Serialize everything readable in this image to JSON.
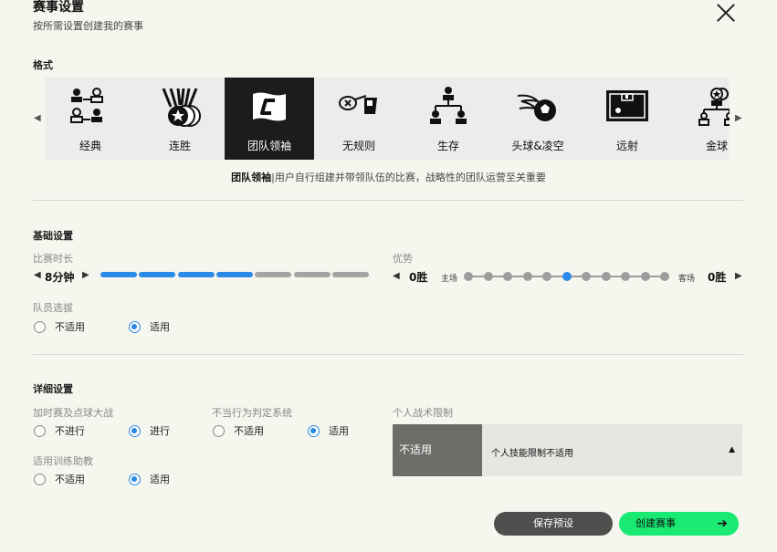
{
  "header": {
    "title": "赛事设置",
    "subtitle": "按所需设置创建我的赛事"
  },
  "format": {
    "section_label": "格式",
    "items": [
      {
        "label": "经典",
        "icon": "bracket-players-icon"
      },
      {
        "label": "连胜",
        "icon": "medals-icon"
      },
      {
        "label": "团队领袖",
        "icon": "captain-flag-icon",
        "selected": true
      },
      {
        "label": "无规则",
        "icon": "whistle-card-icon"
      },
      {
        "label": "生存",
        "icon": "survival-bracket-icon"
      },
      {
        "label": "头球&凌空",
        "icon": "fireball-icon"
      },
      {
        "label": "远射",
        "icon": "goal-board-icon"
      },
      {
        "label": "金球",
        "icon": "golden-ball-icon"
      }
    ],
    "description_name": "团队领袖",
    "description_text": "|用户自行组建并带领队伍的比赛，战略性的团队运营至关重要"
  },
  "basic": {
    "section_label": "基础设置",
    "duration": {
      "label": "比赛时长",
      "value": "8分钟",
      "level": 4,
      "max": 7
    },
    "advantage": {
      "label": "优势",
      "home_value": "0胜",
      "home_label": "主场",
      "away_label": "客场",
      "away_value": "0胜",
      "position": 6,
      "steps": 11
    },
    "player_selection": {
      "label": "队员选拔",
      "options": [
        "不适用",
        "适用"
      ],
      "selected": 1
    }
  },
  "detail": {
    "section_label": "详细设置",
    "extra_time": {
      "label": "加时赛及点球大战",
      "options": [
        "不进行",
        "进行"
      ],
      "selected": 1
    },
    "foul_system": {
      "label": "不当行为判定系统",
      "options": [
        "不适用",
        "适用"
      ],
      "selected": 1
    },
    "coach_assist": {
      "label": "适用训练助教",
      "options": [
        "不适用",
        "适用"
      ],
      "selected": 1
    },
    "tactic_limit": {
      "label": "个人战术限制",
      "value": "不适用",
      "description": "个人技能限制不适用"
    }
  },
  "buttons": {
    "save": "保存预设",
    "create": "创建赛事"
  },
  "colors": {
    "accent_blue": "#2a8ae8",
    "create_green": "#18ea73",
    "selected_dark": "#1c1c1c"
  }
}
